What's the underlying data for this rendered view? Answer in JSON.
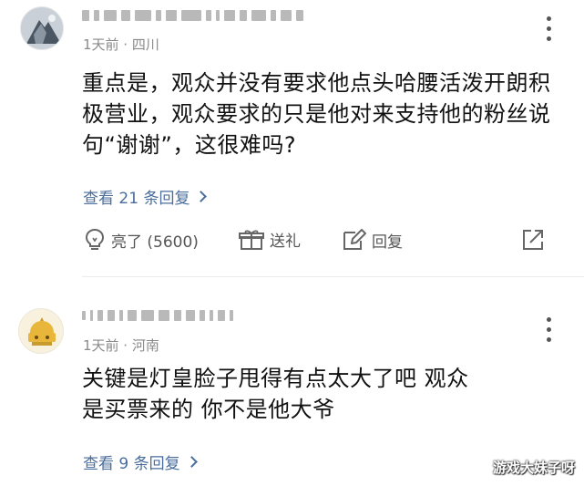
{
  "comments": [
    {
      "meta": "1天前 · 四川",
      "text": "重点是，观众并没有要求他点头哈腰活泼开朗积极营业，观众要求的只是他对来支持他的粉丝说句“谢谢”，这很难吗?",
      "replies_label": "查看 21 条回复",
      "like_label": "亮了 (5600)",
      "gift_label": "送礼",
      "reply_label": "回复"
    },
    {
      "meta": "1天前 · 河南",
      "text": "关键是灯皇脸子甩得有点太大了吧 观众是买票来的 你不是他大爷",
      "replies_label": "查看 9 条回复"
    }
  ],
  "watermark": "游戏大妹子呀",
  "icons": {
    "like": "lightbulb-icon",
    "gift": "gift-icon",
    "reply": "edit-icon",
    "share": "share-icon",
    "more": "more-vertical-icon"
  },
  "colors": {
    "link": "#4a6d9c",
    "meta": "#8a8a8a",
    "text": "#111111"
  }
}
